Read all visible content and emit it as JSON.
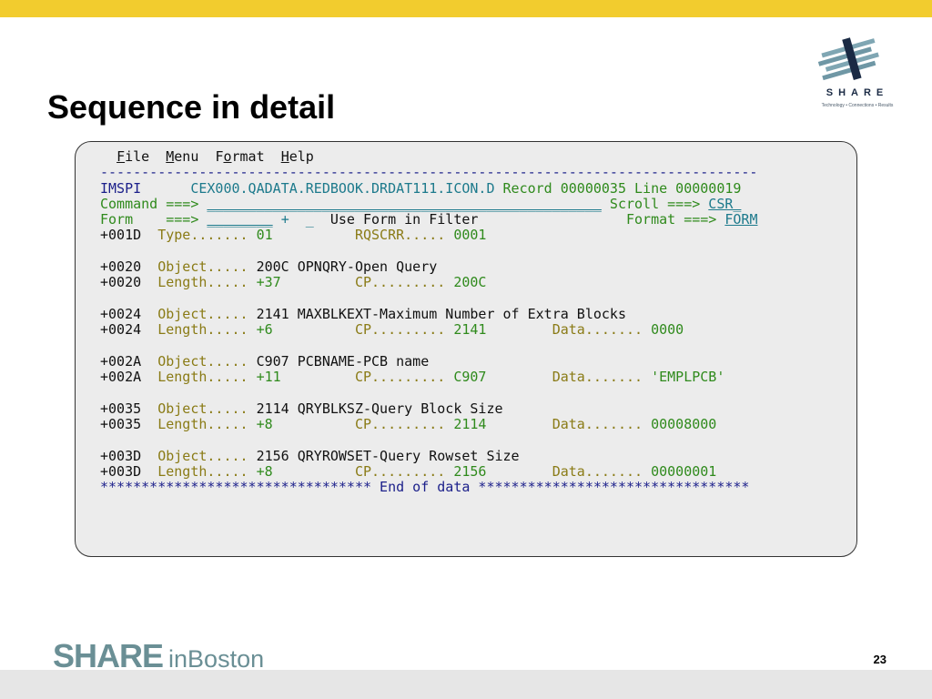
{
  "colors": {
    "top_bar": "#f2cc2e",
    "bottom_band": "#e6e6e6",
    "terminal_background": "#ececec",
    "field_label": "#8a7b16",
    "field_value": "#2f8a1c",
    "header_blue": "#1b1f8a",
    "input_teal": "#1d7a8c",
    "brand_gray_teal": "#6a8f95"
  },
  "slide": {
    "title": "Sequence in detail",
    "page_number": "23"
  },
  "logo": {
    "icon": "share-logo-icon",
    "wordmark": "SHARE",
    "tagline": "Technology • Connections • Results"
  },
  "footer": {
    "brand": "SHARE",
    "in_word": "in",
    "city": "Boston"
  },
  "terminal": {
    "menu": {
      "file": {
        "hotkey": "F",
        "rest": "ile"
      },
      "menu": {
        "hotkey": "M",
        "rest": "enu"
      },
      "format": {
        "prefix": "F",
        "hotkey": "o",
        "rest": "rmat"
      },
      "help": {
        "hotkey": "H",
        "rest": "elp"
      }
    },
    "separator": "--------------------------------------------------------------------------------",
    "header": {
      "system": "IMSPI",
      "dataset": "CEX000.QADATA.REDBOOK.DRDAT111.ICON.D",
      "record_label": "Record",
      "record_value": "00000035",
      "line_label": "Line",
      "line_value": "00000019"
    },
    "command": {
      "label": "Command ===>",
      "value": "",
      "blank": "________________________________________________",
      "scroll_label": "Scroll ===>",
      "scroll_value": "CSR_"
    },
    "form": {
      "label": "Form    ===>",
      "value": "",
      "blank": "________",
      "plus": "+",
      "filter_flag": "_",
      "filter_text": "Use Form in Filter",
      "format_label": "Format ===>",
      "format_value": "FORM"
    },
    "type_row": {
      "offset": "+001D",
      "type_label": "Type.......",
      "type_value": "01",
      "rqscrr_label": "RQSCRR.....",
      "rqscrr_value": "0001"
    },
    "entries": [
      {
        "offset": "+0020",
        "object_label": "Object.....",
        "object_code": "200C",
        "object_name": "OPNQRY-Open Query",
        "length_label": "Length.....",
        "length_value": "+37",
        "cp_label": "CP.........",
        "cp_value": "200C",
        "data_label": "",
        "data_value": ""
      },
      {
        "offset": "+0024",
        "object_label": "Object.....",
        "object_code": "2141",
        "object_name": "MAXBLKEXT-Maximum Number of Extra Blocks",
        "length_label": "Length.....",
        "length_value": "+6",
        "cp_label": "CP.........",
        "cp_value": "2141",
        "data_label": "Data.......",
        "data_value": "0000"
      },
      {
        "offset": "+002A",
        "object_label": "Object.....",
        "object_code": "C907",
        "object_name": "PCBNAME-PCB name",
        "length_label": "Length.....",
        "length_value": "+11",
        "cp_label": "CP.........",
        "cp_value": "C907",
        "data_label": "Data.......",
        "data_value": "'EMPLPCB'"
      },
      {
        "offset": "+0035",
        "object_label": "Object.....",
        "object_code": "2114",
        "object_name": "QRYBLKSZ-Query Block Size",
        "length_label": "Length.....",
        "length_value": "+8",
        "cp_label": "CP.........",
        "cp_value": "2114",
        "data_label": "Data.......",
        "data_value": "00008000"
      },
      {
        "offset": "+003D",
        "object_label": "Object.....",
        "object_code": "2156",
        "object_name": "QRYROWSET-Query Rowset Size",
        "length_label": "Length.....",
        "length_value": "+8",
        "cp_label": "CP.........",
        "cp_value": "2156",
        "data_label": "Data.......",
        "data_value": "00000001"
      }
    ],
    "end_marker": {
      "left_stars": "*********************************",
      "text": "End of data",
      "right_stars": "*********************************"
    }
  }
}
